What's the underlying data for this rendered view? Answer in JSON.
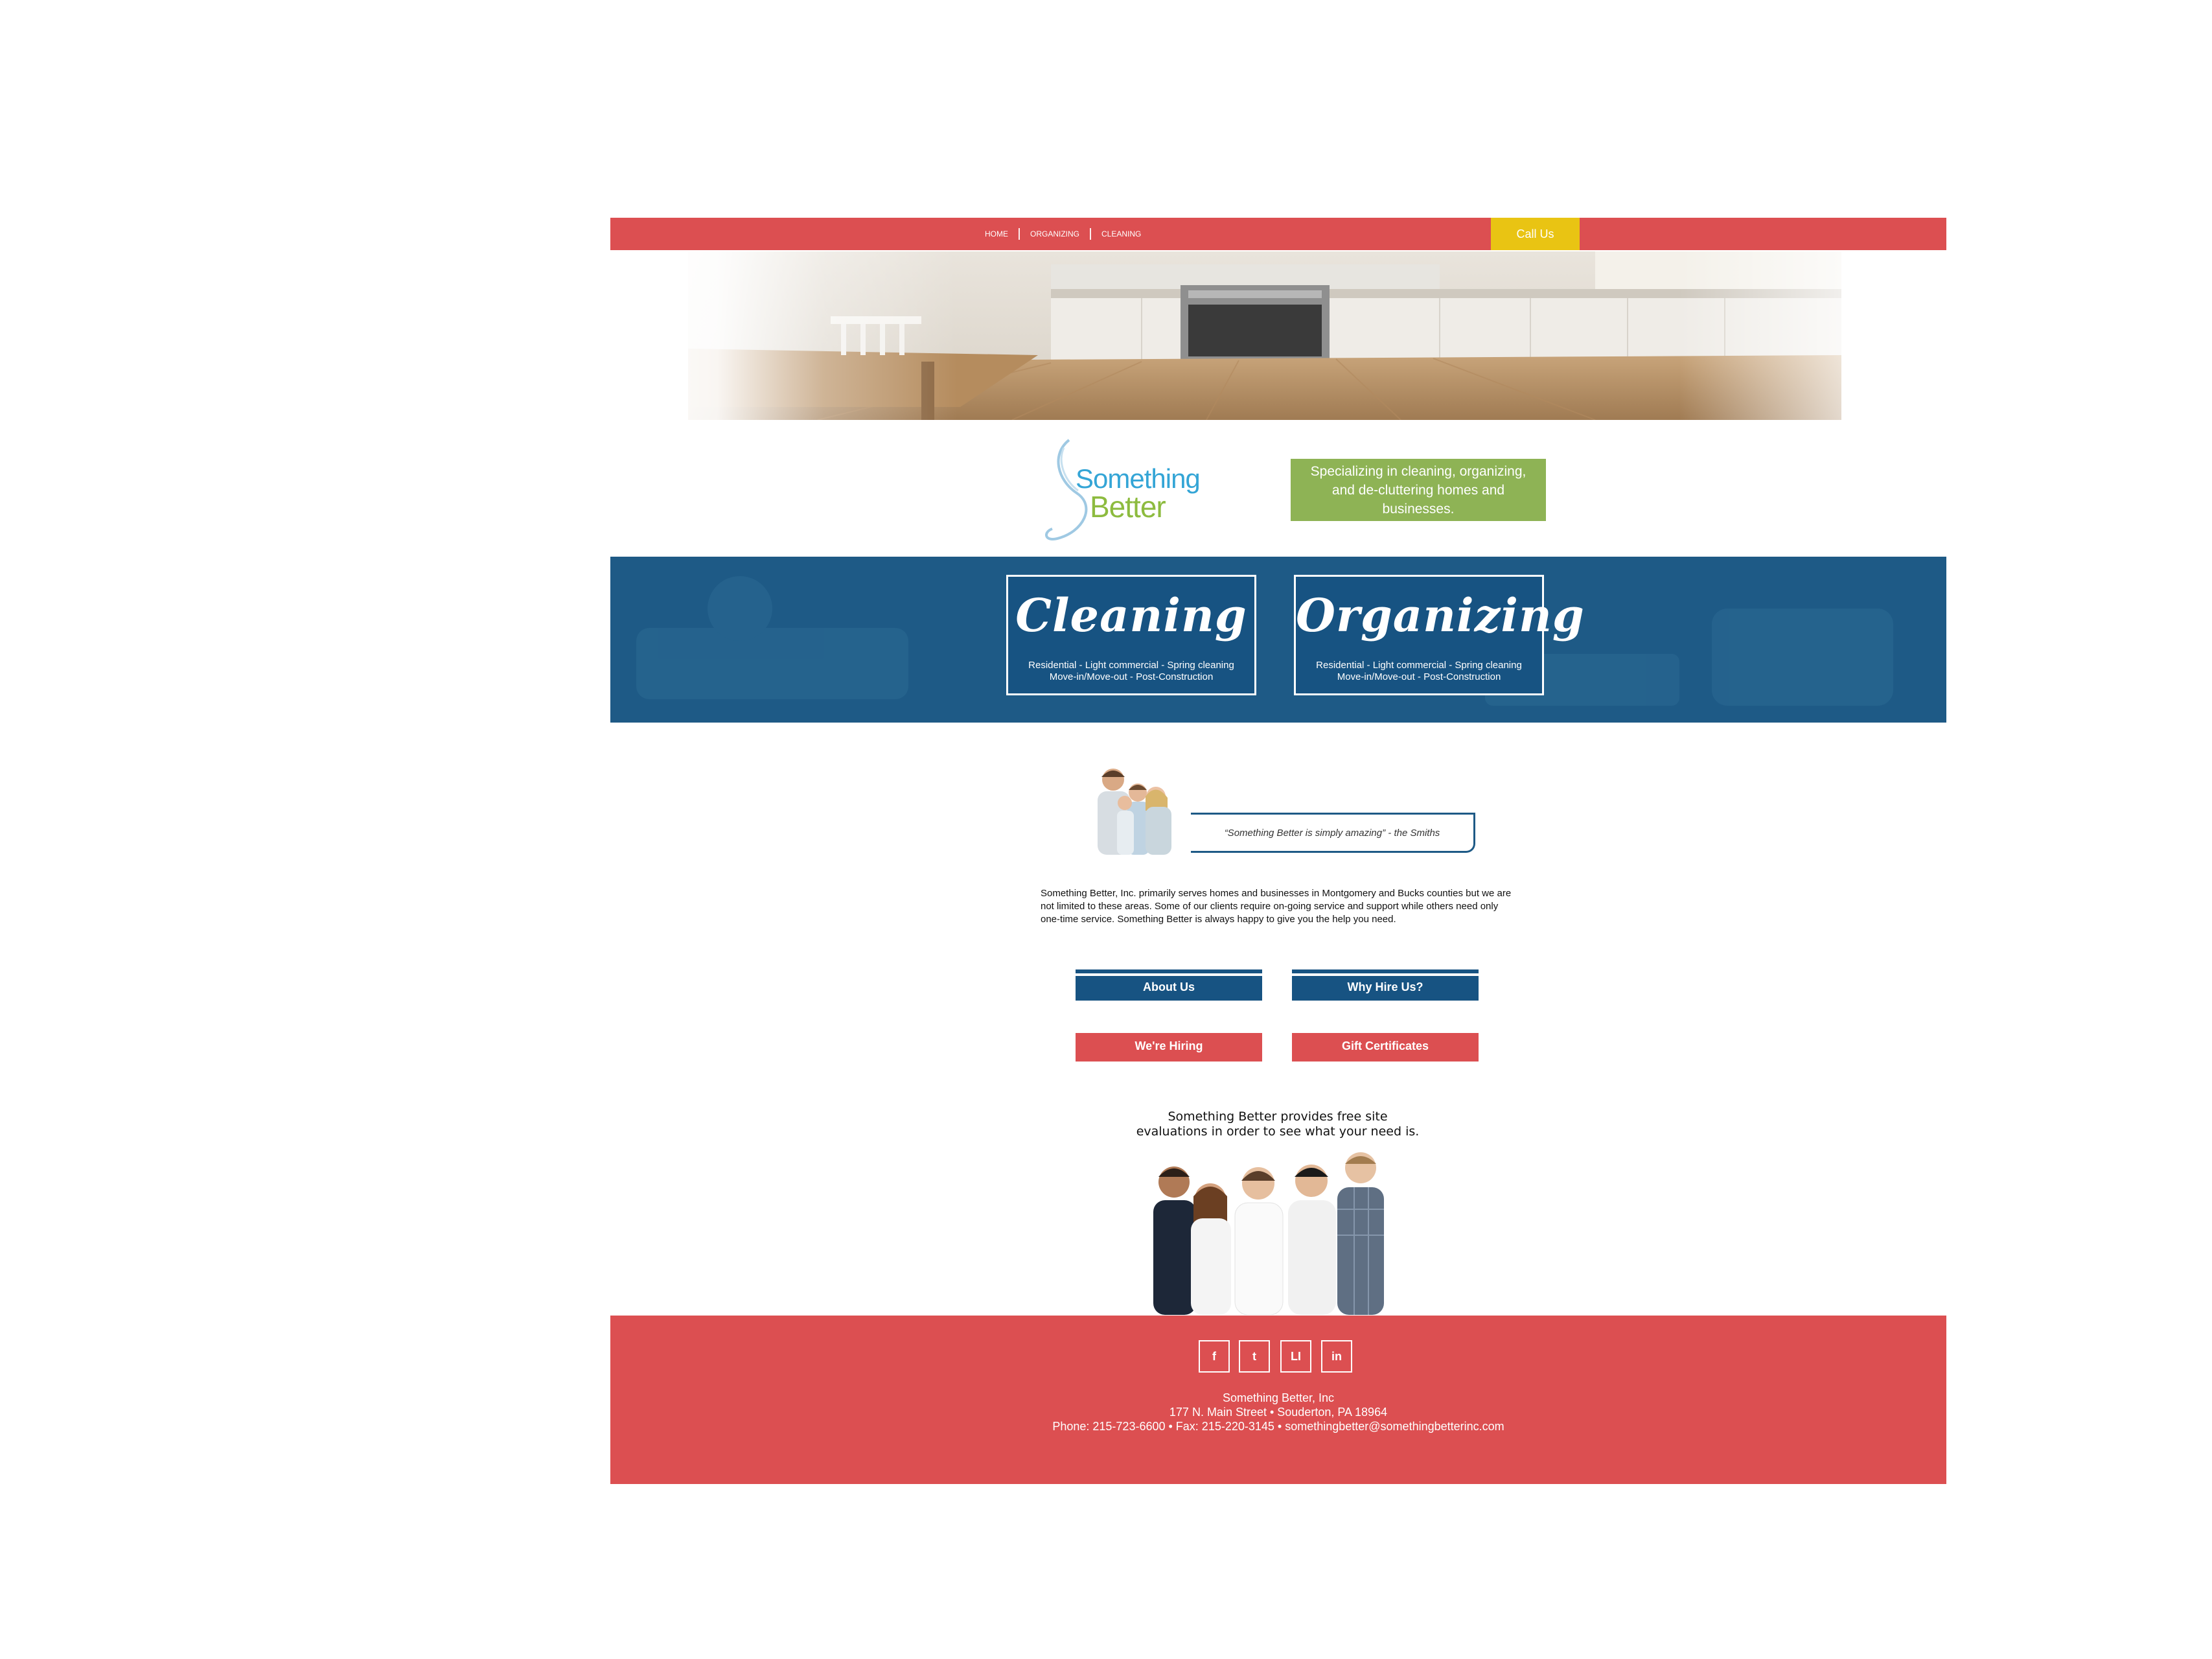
{
  "nav": {
    "links": [
      "HOME",
      "ORGANIZING",
      "CLEANING"
    ],
    "call_label": "Call Us"
  },
  "brand": {
    "logo_line1": "Something",
    "logo_line2": "Better",
    "tagline": "Specializing in cleaning, organizing, and de-cluttering homes and businesses."
  },
  "services": [
    {
      "title": "Cleaning",
      "line1": "Residential - Light commercial - Spring cleaning",
      "line2": "Move-in/Move-out - Post-Construction"
    },
    {
      "title": "Organizing",
      "line1": "Residential - Light commercial - Spring cleaning",
      "line2": "Move-in/Move-out - Post-Construction"
    }
  ],
  "testimonial": {
    "quote": "“Something Better is simply amazing” - the Smiths"
  },
  "about_text": "Something Better, Inc. primarily serves homes and businesses in Montgomery and Bucks counties but we are not limited to these areas. Some of our clients require on-going service and support while others need only one-time service. Something Better is always happy to give you the help you need.",
  "buttons": {
    "about": "About Us",
    "why": "Why Hire Us?",
    "hiring": "We're Hiring",
    "gift": "Gift Certificates"
  },
  "eval_text": {
    "line1": "Something Better provides free site",
    "line2": "evaluations in order to see what your need is."
  },
  "footer": {
    "social": [
      "f",
      "t",
      "LI",
      "in"
    ],
    "company": "Something Better, Inc",
    "address": "177 N. Main Street • Souderton, PA 18964",
    "contact": "Phone: 215-723-6600 • Fax: 215-220-3145 • somethingbetter@somethingbetterinc.com"
  },
  "colors": {
    "red": "#dc4f51",
    "blue": "#175382",
    "yellow": "#e9c413",
    "green": "#8eb355"
  }
}
